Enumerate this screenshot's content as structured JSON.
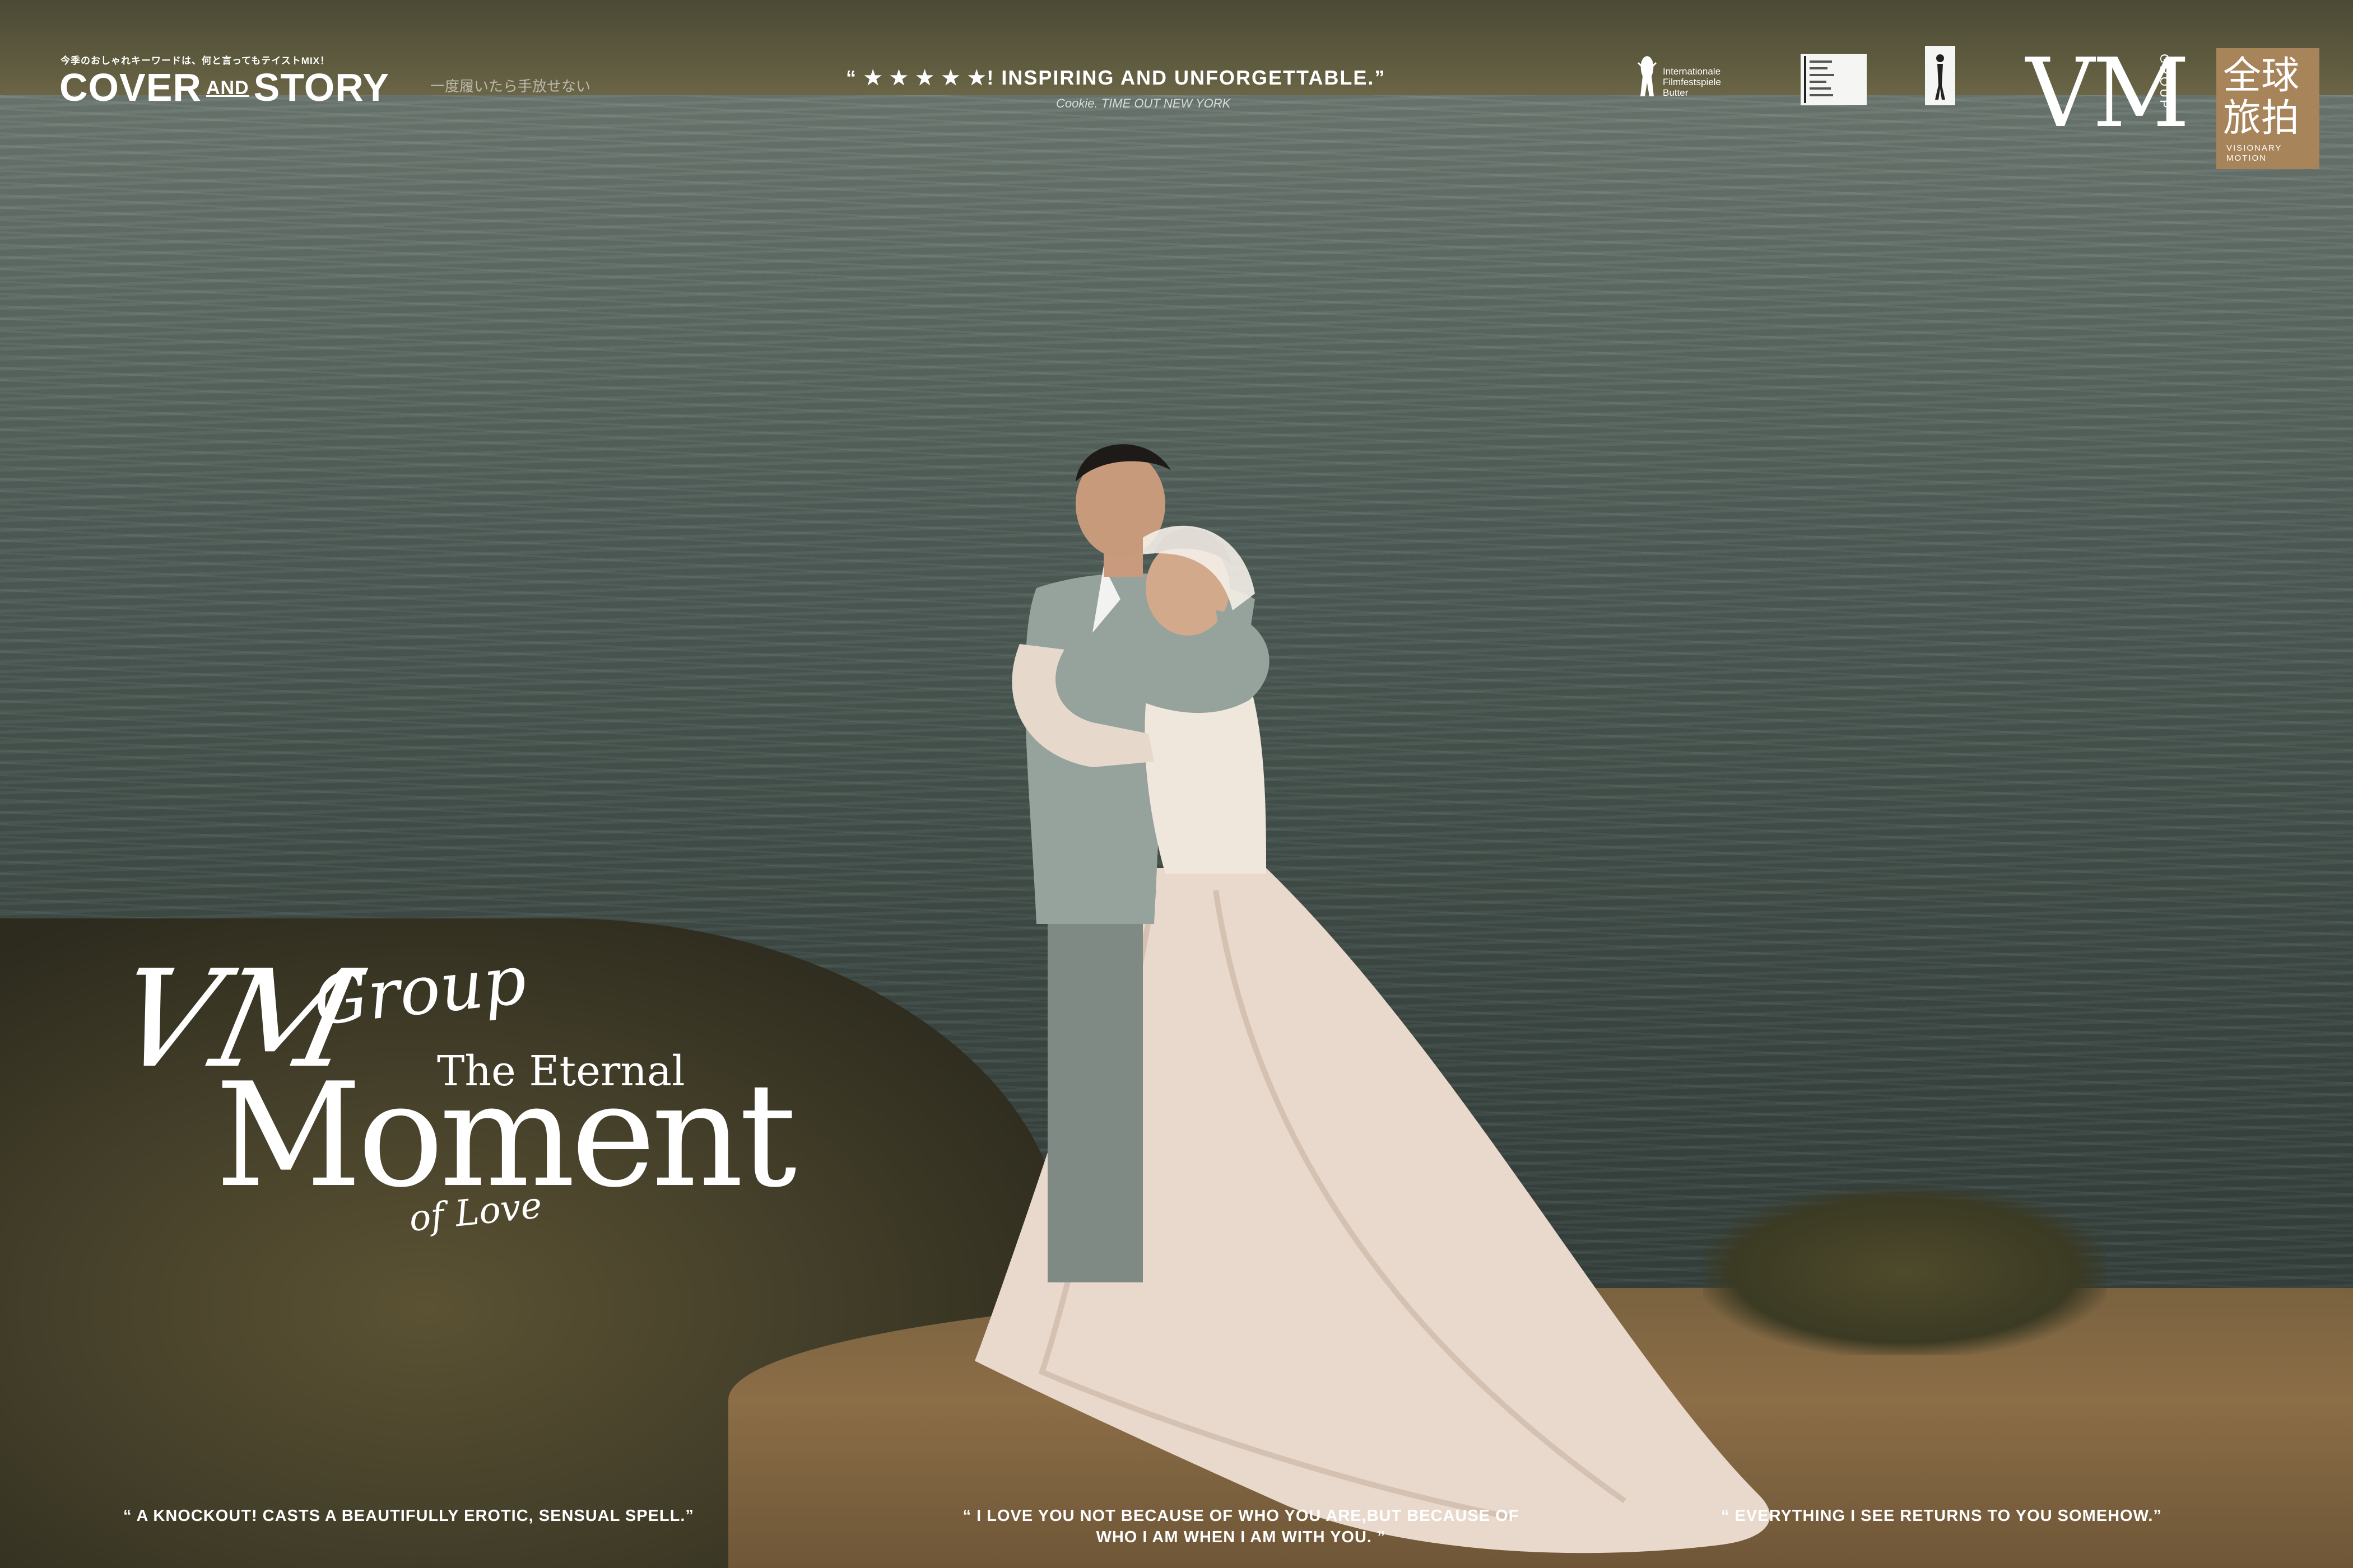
{
  "header": {
    "tagline_jp": "今季のおしゃれキーワードは、何と言ってもテイストMIX！",
    "brand": {
      "part1": "COVER",
      "part2": "AND",
      "part3": "STORY"
    },
    "subtitle_jp": "一度履いたら手放せない",
    "quote": "“ ★ ★ ★ ★ ★! INSPIRING AND UNFORGETTABLE.”",
    "quote_credit": "Cookie. TIME OUT NEW YORK"
  },
  "festival_logo": {
    "lines": [
      "Internationale",
      "Filmfestspiele",
      "Butter"
    ]
  },
  "vm_logo": {
    "letters": "VM",
    "group": "GROUP",
    "chinese": "全球旅拍",
    "english": [
      "VISIONARY",
      "MOTION"
    ],
    "box_color": "#a8845a"
  },
  "title": {
    "script_vm": "VM",
    "script_group": "Group",
    "eternal": "The Eternal",
    "moment": "Moment",
    "of_love": "of Love"
  },
  "bottom_quotes": {
    "left": "“ A KNOCKOUT! CASTS A BEAUTIFULLY EROTIC, SENSUAL SPELL.”",
    "center_line1": "“ I LOVE YOU NOT BECAUSE OF WHO YOU ARE,BUT BECAUSE OF",
    "center_line2": "WHO I AM WHEN I AM WITH YOU. ”",
    "right": "“ EVERYTHING I SEE RETURNS TO YOU SOMEHOW.”"
  }
}
